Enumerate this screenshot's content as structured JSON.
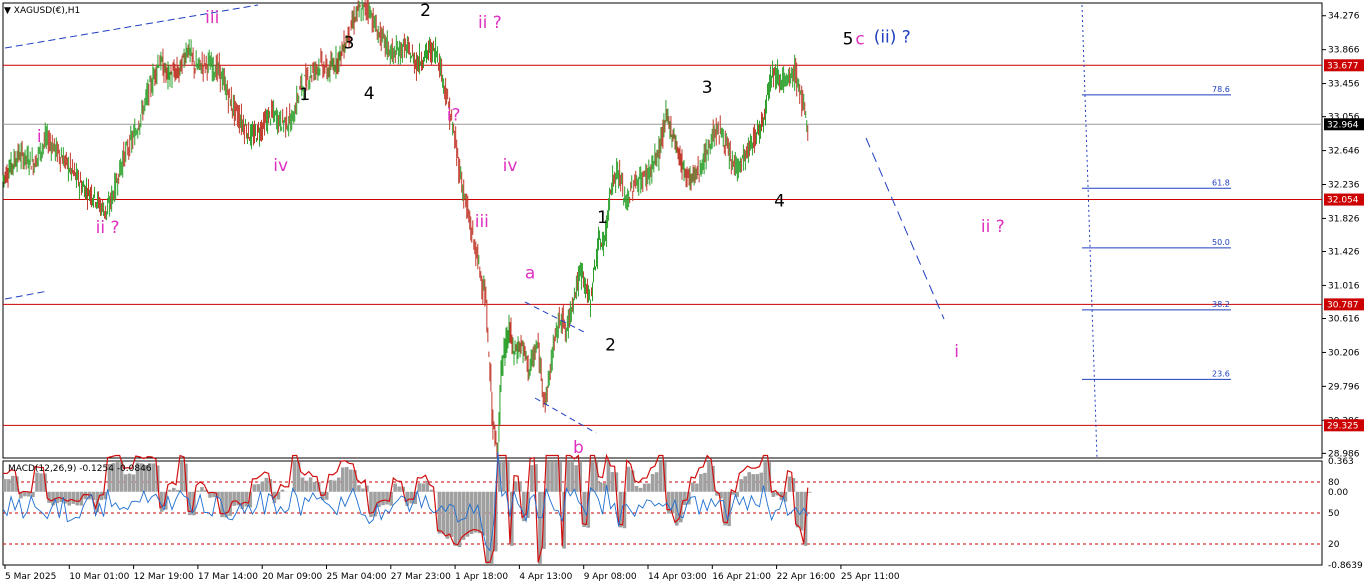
{
  "header": {
    "arrow": "▼",
    "title": "XAGUSD(€),H1"
  },
  "macd": {
    "title": "MACD(12,26,9) -0.1254 -0.0846"
  },
  "colors": {
    "bull": "#2ca02c",
    "bear": "#c0392b",
    "level_line": "#cc0000",
    "fib_line": "#1f3fbf",
    "dashed_blue": "#1f3fbf",
    "magenta": "#e030c0",
    "black": "#000000",
    "current_price_line": "#9a9a9a",
    "macd_hist": "#a0a0a0",
    "macd_signal": "#d01010",
    "macd_main": "#1f6fd0"
  },
  "chart_data": {
    "type": "candlestick",
    "symbol": "XAGUSD(€)",
    "timeframe": "H1",
    "y_ticks": [
      "34.276",
      "33.866",
      "33.456",
      "33.056",
      "32.646",
      "32.236",
      "31.826",
      "31.426",
      "31.016",
      "30.616",
      "30.206",
      "29.796",
      "29.386",
      "28.986"
    ],
    "x_ticks": [
      "5 Mar 2025",
      "10 Mar 01:00",
      "12 Mar 19:00",
      "17 Mar 14:00",
      "20 Mar 09:00",
      "25 Mar 04:00",
      "27 Mar 23:00",
      "1 Apr 18:00",
      "4 Apr 13:00",
      "9 Apr 08:00",
      "14 Apr 03:00",
      "16 Apr 21:00",
      "22 Apr 16:00",
      "25 Apr 11:00"
    ],
    "ylim": [
      28.93,
      34.43
    ],
    "path_points": [
      [
        0,
        32.3
      ],
      [
        4,
        32.6
      ],
      [
        8,
        32.5
      ],
      [
        11,
        32.8
      ],
      [
        15,
        32.55
      ],
      [
        18,
        32.35
      ],
      [
        20,
        32.2
      ],
      [
        23,
        32.1
      ],
      [
        24,
        32.0
      ],
      [
        26,
        31.9
      ],
      [
        28,
        32.2
      ],
      [
        30,
        32.55
      ],
      [
        33,
        32.85
      ],
      [
        36,
        33.3
      ],
      [
        39,
        33.75
      ],
      [
        41,
        33.55
      ],
      [
        44,
        33.6
      ],
      [
        46,
        33.9
      ],
      [
        48,
        33.65
      ],
      [
        51,
        33.7
      ],
      [
        54,
        33.6
      ],
      [
        57,
        33.2
      ],
      [
        60,
        32.95
      ],
      [
        62,
        32.8
      ],
      [
        64,
        32.9
      ],
      [
        67,
        33.1
      ],
      [
        69,
        33.0
      ],
      [
        72,
        33.0
      ],
      [
        74,
        33.4
      ],
      [
        77,
        33.6
      ],
      [
        79,
        33.7
      ],
      [
        81,
        33.6
      ],
      [
        84,
        33.8
      ],
      [
        86,
        34.05
      ],
      [
        88,
        34.3
      ],
      [
        91,
        34.38
      ],
      [
        93,
        34.1
      ],
      [
        95,
        33.95
      ],
      [
        97,
        33.8
      ],
      [
        100,
        33.9
      ],
      [
        103,
        33.7
      ],
      [
        106,
        33.85
      ],
      [
        108,
        33.85
      ],
      [
        110,
        33.4
      ],
      [
        112,
        32.9
      ],
      [
        114,
        32.3
      ],
      [
        116,
        31.8
      ],
      [
        118,
        31.35
      ],
      [
        120,
        30.9
      ],
      [
        122,
        29.3
      ],
      [
        123,
        28.97
      ],
      [
        124,
        30.0
      ],
      [
        126,
        30.5
      ],
      [
        127,
        30.2
      ],
      [
        129,
        30.3
      ],
      [
        131,
        30.0
      ],
      [
        133,
        30.3
      ],
      [
        134,
        29.9
      ],
      [
        135,
        29.6
      ],
      [
        137,
        30.3
      ],
      [
        139,
        30.7
      ],
      [
        140,
        30.4
      ],
      [
        142,
        30.9
      ],
      [
        144,
        31.2
      ],
      [
        146,
        30.8
      ],
      [
        148,
        31.5
      ],
      [
        150,
        31.6
      ],
      [
        151,
        32.2
      ],
      [
        153,
        32.4
      ],
      [
        155,
        32.0
      ],
      [
        157,
        32.25
      ],
      [
        159,
        32.3
      ],
      [
        161,
        32.4
      ],
      [
        163,
        32.6
      ],
      [
        165,
        33.05
      ],
      [
        167,
        32.8
      ],
      [
        169,
        32.45
      ],
      [
        171,
        32.3
      ],
      [
        173,
        32.4
      ],
      [
        175,
        32.6
      ],
      [
        177,
        32.9
      ],
      [
        179,
        32.85
      ],
      [
        181,
        32.5
      ],
      [
        183,
        32.45
      ],
      [
        185,
        32.6
      ],
      [
        187,
        32.8
      ],
      [
        189,
        33.0
      ],
      [
        191,
        33.6
      ],
      [
        193,
        33.55
      ],
      [
        195,
        33.45
      ],
      [
        197,
        33.6
      ],
      [
        199,
        33.2
      ],
      [
        200,
        32.9
      ]
    ],
    "n_bars": 210,
    "x_span": [
      3,
      848
    ],
    "horizontal_levels": [
      "33.677",
      "32.054",
      "30.787",
      "29.325"
    ],
    "current_price": "32.964",
    "fib_levels": [
      {
        "label": "78.6",
        "value": 33.32
      },
      {
        "label": "61.8",
        "value": 32.19
      },
      {
        "label": "50.0",
        "value": 31.47
      },
      {
        "label": "38.2",
        "value": 30.72
      },
      {
        "label": "23.6",
        "value": 29.88
      }
    ],
    "annotations": [
      {
        "text": "i",
        "x": 9,
        "y": 32.75,
        "color": "magenta"
      },
      {
        "text": "ii ?",
        "x": 26,
        "y": 31.65,
        "color": "magenta"
      },
      {
        "text": "iii",
        "x": 52,
        "y": 34.19,
        "color": "magenta"
      },
      {
        "text": "iv",
        "x": 69,
        "y": 32.4,
        "color": "magenta"
      },
      {
        "text": "1",
        "x": 75,
        "y": 33.26,
        "color": "black"
      },
      {
        "text": "3",
        "x": 86,
        "y": 33.88,
        "color": "black"
      },
      {
        "text": "4",
        "x": 91,
        "y": 33.27,
        "color": "black"
      },
      {
        "text": "2",
        "x": 105,
        "y": 34.27,
        "color": "black"
      },
      {
        "text": "ii ?",
        "x": 121,
        "y": 34.13,
        "color": "magenta"
      },
      {
        "text": "i?",
        "x": 112,
        "y": 33.01,
        "color": "magenta"
      },
      {
        "text": "iv",
        "x": 126,
        "y": 32.4,
        "color": "magenta"
      },
      {
        "text": "iii",
        "x": 119,
        "y": 31.72,
        "color": "magenta"
      },
      {
        "text": "a",
        "x": 131,
        "y": 31.1,
        "color": "magenta"
      },
      {
        "text": "b",
        "x": 143,
        "y": 28.99,
        "color": "magenta"
      },
      {
        "text": "1",
        "x": 149,
        "y": 31.77,
        "color": "black"
      },
      {
        "text": "2",
        "x": 151,
        "y": 30.23,
        "color": "black"
      },
      {
        "text": "3",
        "x": 175,
        "y": 33.34,
        "color": "black"
      },
      {
        "text": "4",
        "x": 193,
        "y": 31.97,
        "color": "black"
      },
      {
        "text": "5",
        "x": 210,
        "y": 33.93,
        "color": "black"
      },
      {
        "text": "c",
        "x": 213,
        "y": 33.93,
        "color": "magenta"
      },
      {
        "text": "(ii) ?",
        "x": 221,
        "y": 33.95,
        "color": "blue"
      },
      {
        "text": "ii ?",
        "x": 246,
        "y": 31.66,
        "color": "magenta"
      },
      {
        "text": "i",
        "x": 237,
        "y": 30.15,
        "color": "magenta"
      }
    ],
    "macd_ticks": [
      "0.363",
      "0.00",
      "-0.8639"
    ],
    "macd_levels": [
      "80",
      "50",
      "20"
    ],
    "macd_values": {
      "main": -0.1254,
      "signal": -0.0846
    }
  }
}
